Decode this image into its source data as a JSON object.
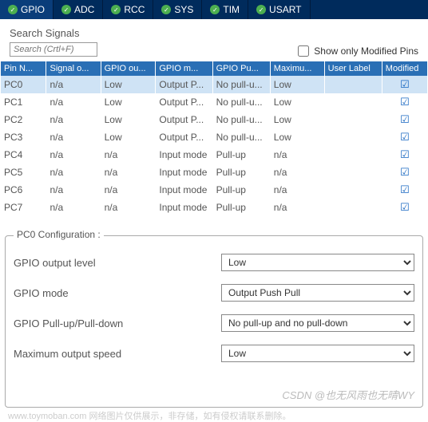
{
  "tabs": [
    {
      "label": "GPIO",
      "active": true
    },
    {
      "label": "ADC",
      "active": false
    },
    {
      "label": "RCC",
      "active": false
    },
    {
      "label": "SYS",
      "active": false
    },
    {
      "label": "TIM",
      "active": false
    },
    {
      "label": "USART",
      "active": false
    }
  ],
  "search": {
    "label": "Search Signals",
    "placeholder": "Search (Crtl+F)",
    "show_only_label": "Show only Modified Pins"
  },
  "headers": {
    "pin": "Pin N...",
    "signal": "Signal o...",
    "gpio_out": "GPIO ou...",
    "gpio_mode": "GPIO m...",
    "gpio_pull": "GPIO Pu...",
    "maximum": "Maximu...",
    "user": "User Label",
    "modified": "Modified"
  },
  "rows": [
    {
      "pin": "PC0",
      "signal": "n/a",
      "out": "Low",
      "mode": "Output P...",
      "pull": "No pull-u...",
      "max": "Low",
      "user": "",
      "modified": true,
      "selected": true
    },
    {
      "pin": "PC1",
      "signal": "n/a",
      "out": "Low",
      "mode": "Output P...",
      "pull": "No pull-u...",
      "max": "Low",
      "user": "",
      "modified": true,
      "selected": false
    },
    {
      "pin": "PC2",
      "signal": "n/a",
      "out": "Low",
      "mode": "Output P...",
      "pull": "No pull-u...",
      "max": "Low",
      "user": "",
      "modified": true,
      "selected": false
    },
    {
      "pin": "PC3",
      "signal": "n/a",
      "out": "Low",
      "mode": "Output P...",
      "pull": "No pull-u...",
      "max": "Low",
      "user": "",
      "modified": true,
      "selected": false
    },
    {
      "pin": "PC4",
      "signal": "n/a",
      "out": "n/a",
      "mode": "Input mode",
      "pull": "Pull-up",
      "max": "n/a",
      "user": "",
      "modified": true,
      "selected": false
    },
    {
      "pin": "PC5",
      "signal": "n/a",
      "out": "n/a",
      "mode": "Input mode",
      "pull": "Pull-up",
      "max": "n/a",
      "user": "",
      "modified": true,
      "selected": false
    },
    {
      "pin": "PC6",
      "signal": "n/a",
      "out": "n/a",
      "mode": "Input mode",
      "pull": "Pull-up",
      "max": "n/a",
      "user": "",
      "modified": true,
      "selected": false
    },
    {
      "pin": "PC7",
      "signal": "n/a",
      "out": "n/a",
      "mode": "Input mode",
      "pull": "Pull-up",
      "max": "n/a",
      "user": "",
      "modified": true,
      "selected": false
    }
  ],
  "config": {
    "legend": "PC0 Configuration :",
    "fields": {
      "output_level": {
        "label": "GPIO output level",
        "value": "Low"
      },
      "mode": {
        "label": "GPIO mode",
        "value": "Output Push Pull"
      },
      "pull": {
        "label": "GPIO Pull-up/Pull-down",
        "value": "No pull-up and no pull-down"
      },
      "speed": {
        "label": "Maximum output speed",
        "value": "Low"
      }
    }
  },
  "watermark": "CSDN @也无风雨也无晴WY",
  "watermark2": "www.toymoban.com 网络图片仅供展示，非存储，如有侵权请联系删除。"
}
